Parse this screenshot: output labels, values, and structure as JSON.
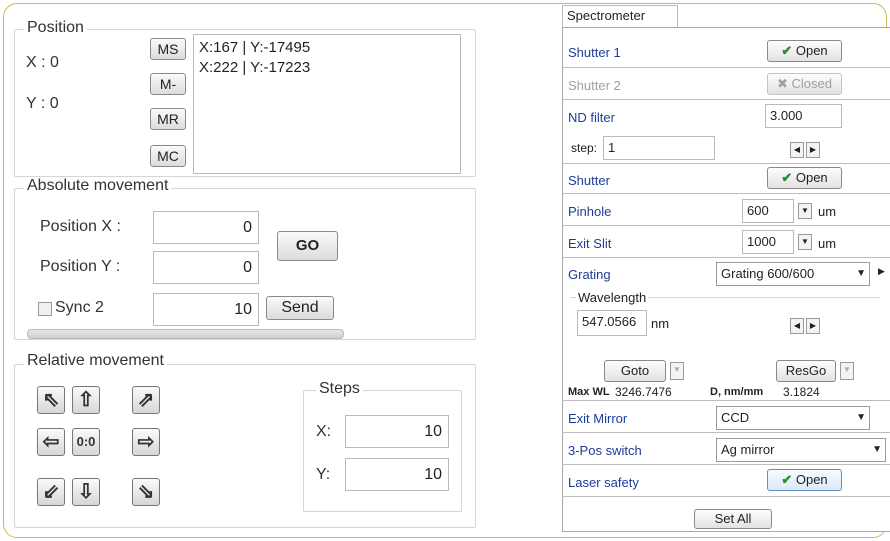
{
  "position": {
    "title": "Position",
    "x_label": "X : 0",
    "y_label": "Y : 0",
    "buttons": {
      "ms": "MS",
      "m_minus": "M-",
      "mr": "MR",
      "mc": "MC"
    },
    "memory": [
      "X:167 | Y:-17495",
      "X:222 | Y:-17223"
    ]
  },
  "absolute": {
    "title": "Absolute movement",
    "pos_x_label": "Position X :",
    "pos_x_value": "0",
    "pos_y_label": "Position Y :",
    "pos_y_value": "0",
    "go": "GO",
    "sync_label": "Sync 2",
    "sync_value": "10",
    "send": "Send"
  },
  "relative": {
    "title": "Relative movement",
    "center": "0:0",
    "steps_title": "Steps",
    "x_label": "X:",
    "x_value": "10",
    "y_label": "Y:",
    "y_value": "10"
  },
  "spectrometer": {
    "tab": "Spectrometer",
    "shutter1": {
      "label": "Shutter 1",
      "button": "Open"
    },
    "shutter2": {
      "label": "Shutter 2",
      "button": "Closed"
    },
    "nd_filter": {
      "label": "ND filter",
      "value": "3.000",
      "step_label": "step:",
      "step_value": "1"
    },
    "shutter": {
      "label": "Shutter",
      "button": "Open"
    },
    "pinhole": {
      "label": "Pinhole",
      "value": "600",
      "unit": "um"
    },
    "exit_slit": {
      "label": "Exit Slit",
      "value": "1000",
      "unit": "um"
    },
    "grating": {
      "label": "Grating",
      "value": "Grating 600/600"
    },
    "wavelength": {
      "title": "Wavelength",
      "value": "547.0566",
      "unit": "nm"
    },
    "goto": "Goto",
    "resgo": "ResGo",
    "max_wl_label": "Max WL",
    "max_wl_value": "3246.7476",
    "d_label": "D, nm/mm",
    "d_value": "3.1824",
    "exit_mirror": {
      "label": "Exit Mirror",
      "value": "CCD"
    },
    "pos3_switch": {
      "label": "3-Pos switch",
      "value": "Ag mirror"
    },
    "laser_safety": {
      "label": "Laser safety",
      "button": "Open"
    },
    "set_all": "Set All"
  },
  "colors": {
    "frame": "#d9b45a",
    "label_blue": "#1f3c9a",
    "check_green": "#2e8b2e"
  }
}
